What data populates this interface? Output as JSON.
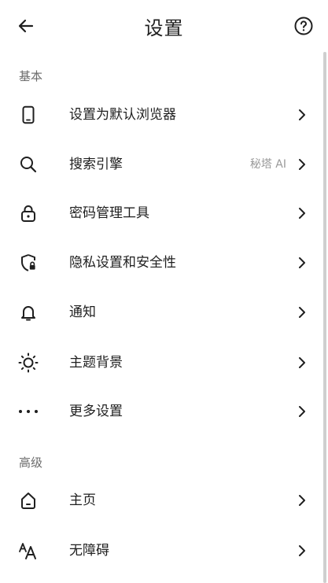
{
  "header": {
    "title": "设置",
    "back_icon": "arrow-left-icon",
    "help_icon": "help-circle-icon"
  },
  "sections": {
    "basic": {
      "title": "基本"
    },
    "advanced": {
      "title": "高级"
    }
  },
  "items": {
    "default_browser": {
      "label": "设置为默认浏览器",
      "icon": "phone-icon"
    },
    "search_engine": {
      "label": "搜索引擎",
      "value": "秘塔 AI",
      "icon": "search-icon"
    },
    "password_manager": {
      "label": "密码管理工具",
      "icon": "lock-icon"
    },
    "privacy": {
      "label": "隐私设置和安全性",
      "icon": "shield-lock-icon"
    },
    "notifications": {
      "label": "通知",
      "icon": "bell-icon"
    },
    "theme": {
      "label": "主题背景",
      "icon": "sun-icon"
    },
    "more_settings": {
      "label": "更多设置",
      "icon": "more-dots-icon"
    },
    "homepage": {
      "label": "主页",
      "icon": "home-icon"
    },
    "accessibility": {
      "label": "无障碍",
      "icon": "text-size-icon"
    }
  },
  "colors": {
    "text": "#1f1f1f",
    "secondary_text": "#6b6b6b",
    "value_text": "#9a9a9a",
    "background": "#ffffff"
  }
}
